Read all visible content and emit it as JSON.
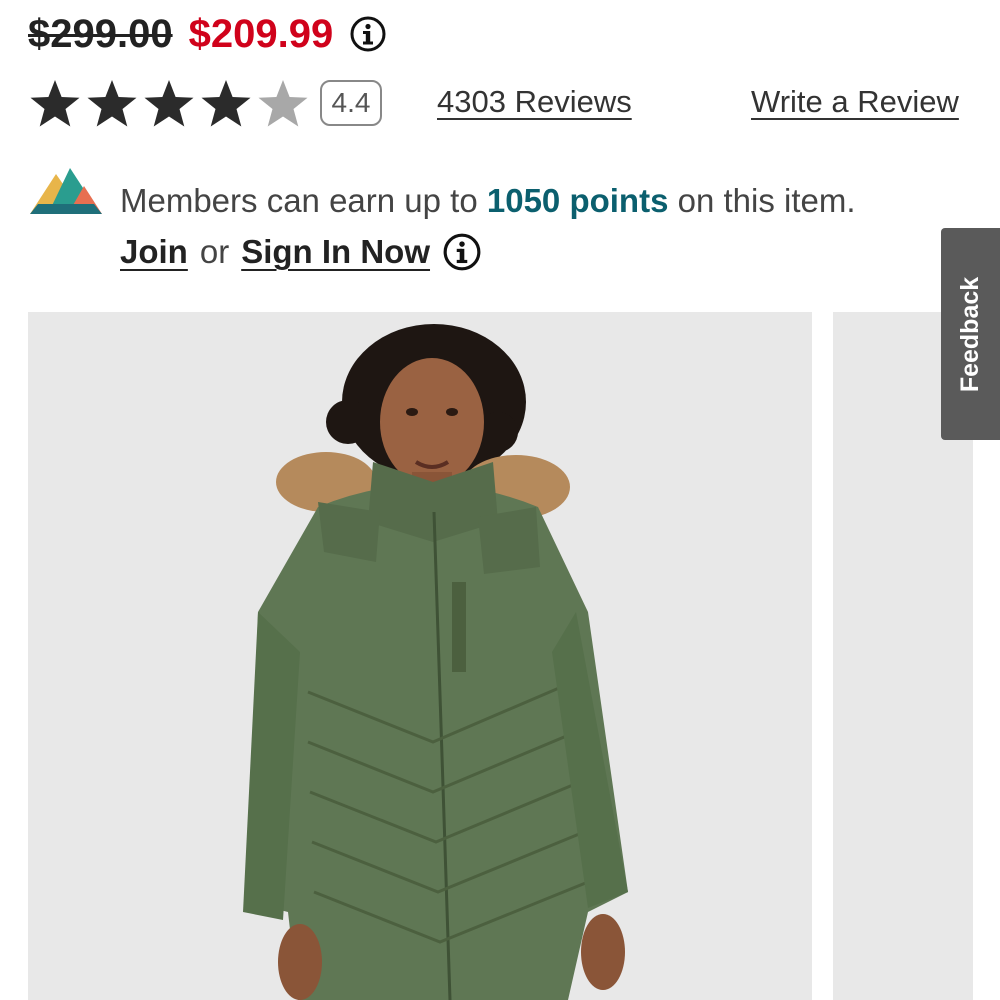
{
  "price": {
    "original": "$299.00",
    "sale": "$209.99"
  },
  "rating": {
    "value": "4.4",
    "stars_filled": 4,
    "stars_total": 5,
    "reviews_link": "4303 Reviews",
    "write_review_link": "Write a Review"
  },
  "members": {
    "text_prefix": "Members can earn up to ",
    "points": "1050 points",
    "text_suffix": " on this item.",
    "join_label": "Join",
    "or_text": "or",
    "signin_label": "Sign In Now"
  },
  "feedback": {
    "label": "Feedback"
  },
  "colors": {
    "sale_price": "#d0021b",
    "points": "#0b5f6e",
    "star_filled": "#2b2b2b",
    "star_empty": "#a8a8a8",
    "feedback_tab": "#5a5a5a",
    "image_background": "#e8e8e8"
  },
  "icons": {
    "price_info": "info-circle-icon",
    "members_logo": "mountain-logo-icon",
    "members_info": "info-circle-icon"
  }
}
